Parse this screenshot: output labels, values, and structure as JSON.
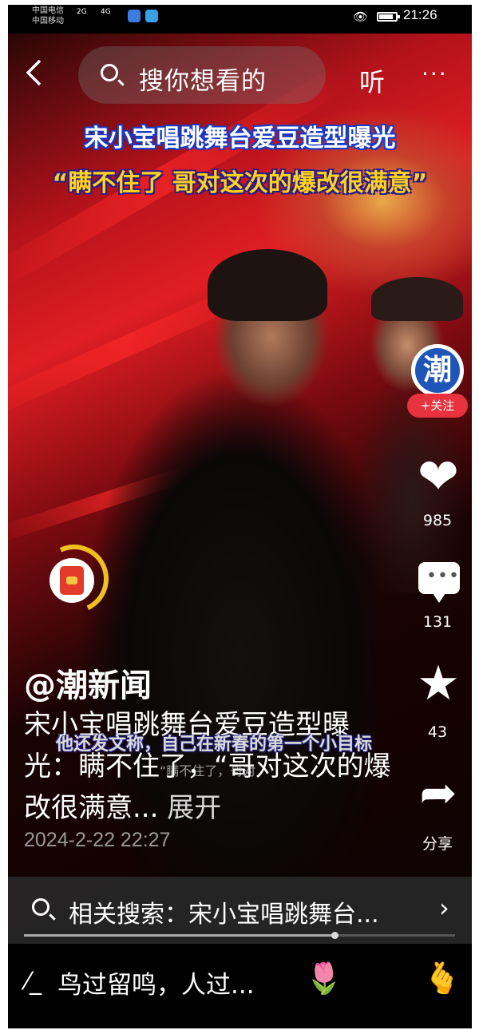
{
  "status_bar": {
    "carrier_line1": "中国电信",
    "carrier_line2": "中国移动",
    "net1": "2G",
    "net2": "4G",
    "time": "21:26"
  },
  "nav": {
    "back_icon": "chevron-left-icon",
    "search_placeholder": "搜你想看的",
    "listen_label": "听",
    "more_label": "···"
  },
  "video": {
    "headline_line1": "宋小宝唱跳舞台爱豆造型曝光",
    "headline_line2": "“瞒不住了 哥对这次的爆改很满意”",
    "subtitle": "他还发文称，自己在新春的第一个小目标",
    "subtitle_overlay": "“瞒不住了，哥对",
    "accent_color": "#e01e23"
  },
  "rail": {
    "avatar_text": "潮",
    "follow_label": "+关注",
    "likes": "985",
    "comments": "131",
    "favorites": "43",
    "share_label": "分享"
  },
  "post": {
    "author": "@潮新闻",
    "description": "宋小宝唱跳舞台爱豆造型曝光：瞒不住了，“哥对这次的爆改很满意...",
    "expand_label": "展开",
    "date": "2024-2-22 22:27"
  },
  "related": {
    "text": "相关搜索：宋小宝唱跳舞台...",
    "chevron": "›"
  },
  "playback": {
    "progress": 0.72
  },
  "comment_bar": {
    "pen_icon": "pen-icon",
    "placeholder": "鸟过留鸣，人过...",
    "emoji1": "🌷",
    "emoji2": "😁",
    "emoji3": "🫰"
  }
}
